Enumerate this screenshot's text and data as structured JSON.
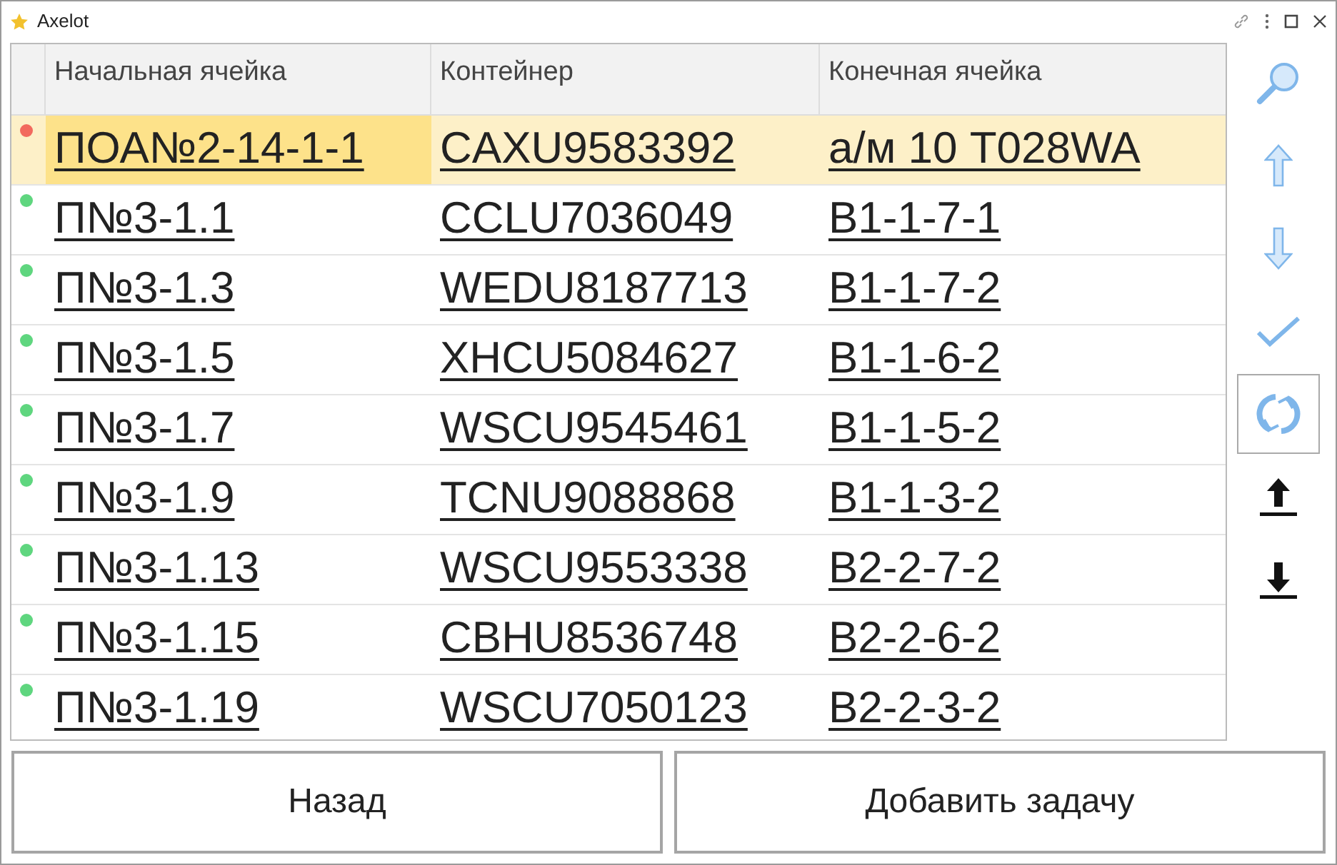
{
  "window": {
    "title": "Axelot"
  },
  "table": {
    "columns": [
      "Начальная ячейка",
      "Контейнер",
      "Конечная ячейка"
    ],
    "rows": [
      {
        "color": "#f26a5e",
        "selected": true,
        "cells": [
          "ПОА№2-14-1-1",
          "CAXU9583392",
          "а/м 10 Т028WA"
        ]
      },
      {
        "color": "#5fd67f",
        "selected": false,
        "cells": [
          "П№3-1.1",
          "CCLU7036049",
          "В1-1-7-1"
        ]
      },
      {
        "color": "#5fd67f",
        "selected": false,
        "cells": [
          "П№3-1.3",
          "WEDU8187713",
          "В1-1-7-2"
        ]
      },
      {
        "color": "#5fd67f",
        "selected": false,
        "cells": [
          "П№3-1.5",
          "XHCU5084627",
          "В1-1-6-2"
        ]
      },
      {
        "color": "#5fd67f",
        "selected": false,
        "cells": [
          "П№3-1.7",
          "WSCU9545461",
          "В1-1-5-2"
        ]
      },
      {
        "color": "#5fd67f",
        "selected": false,
        "cells": [
          "П№3-1.9",
          "TCNU9088868",
          "В1-1-3-2"
        ]
      },
      {
        "color": "#5fd67f",
        "selected": false,
        "cells": [
          "П№3-1.13",
          "WSCU9553338",
          "В2-2-7-2"
        ]
      },
      {
        "color": "#5fd67f",
        "selected": false,
        "cells": [
          "П№3-1.15",
          "CBHU8536748",
          "В2-2-6-2"
        ]
      },
      {
        "color": "#5fd67f",
        "selected": false,
        "cells": [
          "П№3-1.19",
          "WSCU7050123",
          "В2-2-3-2"
        ]
      }
    ]
  },
  "toolbar": [
    {
      "kind": "search",
      "pressed": false
    },
    {
      "kind": "up",
      "pressed": false
    },
    {
      "kind": "down",
      "pressed": false
    },
    {
      "kind": "check",
      "pressed": false
    },
    {
      "kind": "refresh",
      "pressed": true
    },
    {
      "kind": "upload",
      "pressed": false
    },
    {
      "kind": "download",
      "pressed": false
    }
  ],
  "buttons": [
    "Назад",
    "Добавить задачу"
  ]
}
